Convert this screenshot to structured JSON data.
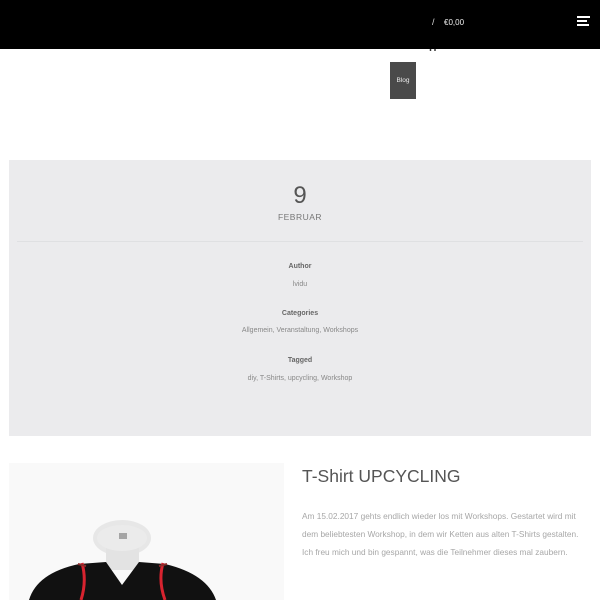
{
  "header": {
    "cart_separator": "/",
    "cart_total": "€0,00",
    "menu_icon": "hamburger-icon",
    "cart_icon": "shopping-cart-icon"
  },
  "breadcrumb": {
    "label": "Blog"
  },
  "post_meta": {
    "day": "9",
    "month": "FEBRUAR",
    "author_label": "Author",
    "author": "lvidu",
    "categories_label": "Categories",
    "categories": "Allgemein, Veranstaltung, Workshops",
    "tagged_label": "Tagged",
    "tags": "diy, T-Shirts, upcycling, Workshop"
  },
  "post": {
    "title": "T-Shirt UPCYCLING",
    "excerpt": "Am 15.02.2017 gehts endlich wieder los mit Workshops. Gestartet wird mit dem beliebtesten Workshop, in dem wir Ketten aus alten T-Shirts gestalten. Ich freu mich und bin gespannt, was die Teilnehmer dieses mal zaubern."
  },
  "colors": {
    "header_bg": "#000000",
    "panel_bg": "#ebebed",
    "accent_red": "#d8232f"
  }
}
